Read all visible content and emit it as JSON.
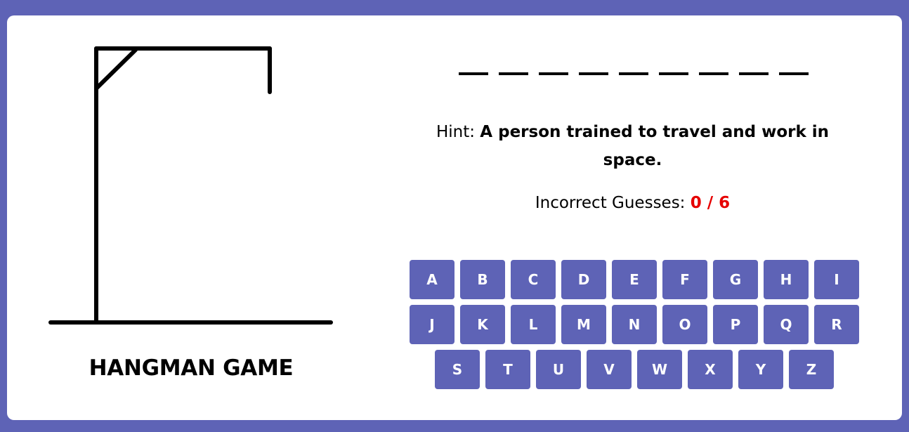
{
  "game": {
    "title": "HANGMAN GAME",
    "word_length": 9,
    "hint_label": "Hint:",
    "hint_text": "A person trained to travel and work in space.",
    "guesses_label": "Incorrect Guesses:",
    "guesses_count": "0 / 6",
    "incorrect_guesses": 0,
    "max_guesses": 6
  },
  "keyboard": {
    "rows": [
      [
        "A",
        "B",
        "C",
        "D",
        "E",
        "F",
        "G",
        "H",
        "I"
      ],
      [
        "J",
        "K",
        "L",
        "M",
        "N",
        "O",
        "P",
        "Q",
        "R"
      ],
      [
        "S",
        "T",
        "U",
        "V",
        "W",
        "X",
        "Y",
        "Z"
      ]
    ]
  },
  "colors": {
    "background": "#5e63b6",
    "card": "#ffffff",
    "key": "#5e63b6",
    "key_text": "#ffffff",
    "guess_count": "#e60000"
  }
}
